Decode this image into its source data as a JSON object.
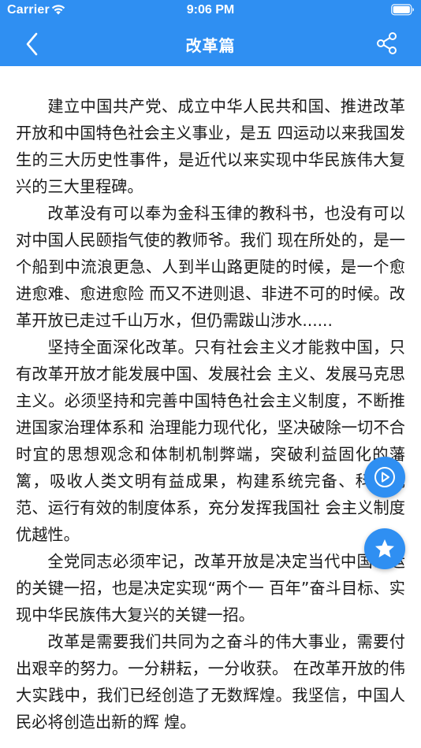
{
  "status_bar": {
    "carrier": "Carrier",
    "time": "9:06 PM"
  },
  "nav": {
    "title": "改革篇"
  },
  "article": {
    "paragraphs": [
      "建立中国共产党、成立中华人民共和国、推进改革开放和中国特色社会主义事业，是五 四运动以来我国发生的三大历史性事件，是近代以来实现中华民族伟大复兴的三大里程碑。",
      "改革没有可以奉为金科玉律的教科书，也没有可以对中国人民颐指气使的教师爷。我们 现在所处的，是一个船到中流浪更急、人到半山路更陡的时候，是一个愈进愈难、愈进愈险 而又不进则退、非进不可的时候。改革开放已走过千山万水，但仍需跋山涉水......",
      "坚持全面深化改革。只有社会主义才能救中国，只有改革开放才能发展中国、发展社会 主义、发展马克思主义。必须坚持和完善中国特色社会主义制度，不断推进国家治理体系和 治理能力现代化，坚决破除一切不合时宜的思想观念和体制机制弊端，突破利益固化的藩篱，吸收人类文明有益成果，构建系统完备、科学规范、运行有效的制度体系，充分发挥我国社 会主义制度优越性。",
      "全党同志必须牢记，改革开放是决定当代中国命运的关键一招，也是决定实现“两个一 百年”奋斗目标、实现中华民族伟大复兴的关键一招。",
      " 改革是需要我们共同为之奋斗的伟大事业，需要付出艰辛的努力。一分耕耘，一分收获。 在改革开放的伟大实践中，我们已经创造了无数辉煌。我坚信，中国人民必将创造出新的辉 煌。"
    ]
  },
  "icons": {
    "back": "chevron-left-icon",
    "share": "share-icon",
    "play": "play-circle-icon",
    "favorite": "star-icon",
    "wifi": "wifi-icon",
    "battery": "battery-icon"
  },
  "colors": {
    "accent": "#2f8ff2",
    "text": "#1a1a1a",
    "background": "#ffffff"
  }
}
